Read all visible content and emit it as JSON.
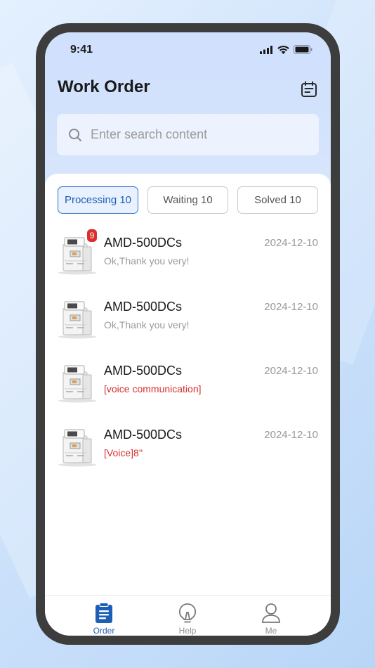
{
  "status_bar": {
    "time": "9:41"
  },
  "header": {
    "title": "Work Order"
  },
  "search": {
    "placeholder": "Enter search content"
  },
  "tabs": [
    {
      "label": "Processing 10",
      "active": true
    },
    {
      "label": "Waiting 10",
      "active": false
    },
    {
      "label": "Solved 10",
      "active": false
    }
  ],
  "orders": [
    {
      "title": "AMD-500DCs",
      "date": "2024-12-10",
      "message": "Ok,Thank you very!",
      "badge": "9"
    },
    {
      "title": "AMD-500DCs",
      "date": "2024-12-10",
      "message": "Ok,Thank you very!"
    },
    {
      "title": "AMD-500DCs",
      "date": "2024-12-10",
      "message": "[voice communication]",
      "message_color": "#d63131"
    },
    {
      "title": "AMD-500DCs",
      "date": "2024-12-10",
      "message": "[Voice]8''",
      "message_color": "#d63131"
    }
  ],
  "bottom_nav": [
    {
      "label": "Order",
      "icon": "clipboard-icon",
      "active": true
    },
    {
      "label": "Help",
      "icon": "lightbulb-icon"
    },
    {
      "label": "Me",
      "icon": "user-icon"
    }
  ],
  "colors": {
    "accent": "#1d5fb6",
    "alert": "#d63131",
    "badge": "#dd2e2e"
  }
}
